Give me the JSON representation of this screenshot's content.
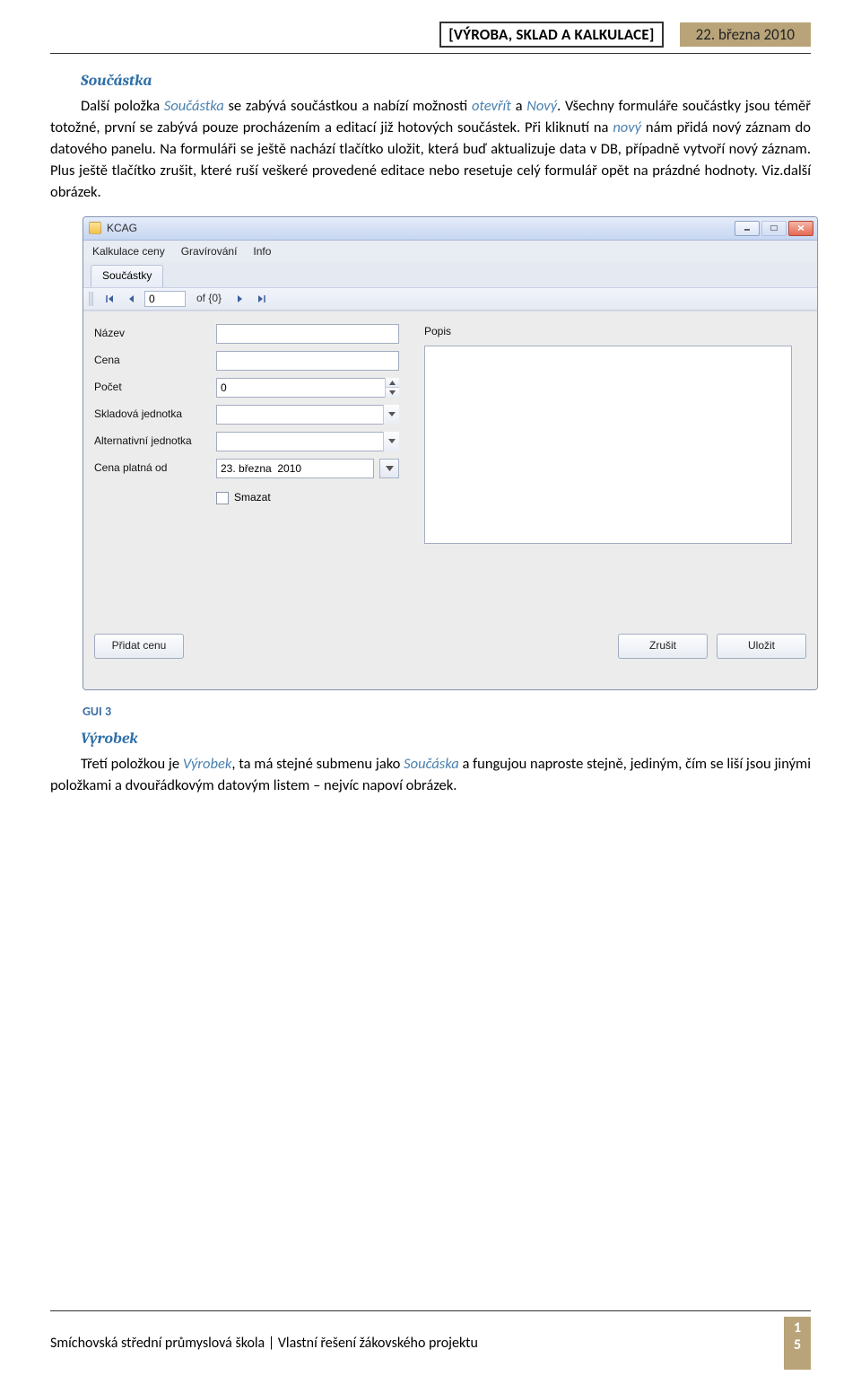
{
  "doc": {
    "header_title": "[VÝROBA, SKLAD A KALKULACE]",
    "header_date": "22. března 2010",
    "section1_heading": "Součástka",
    "paragraph1_a": "Další položka ",
    "paragraph1_link1": "Součástka",
    "paragraph1_b": " se zabývá součástkou a nabízí možnosti ",
    "paragraph1_link2": "otevřít",
    "paragraph1_c": " a ",
    "paragraph1_link3": "Nový",
    "paragraph1_d": ". Všechny formuláře součástky jsou téměř totožné, první se zabývá pouze procházením a editací již hotových součástek. Při kliknutí na ",
    "paragraph1_link4": "nový",
    "paragraph1_e": " nám přidá nový záznam do datového panelu. Na formuláři se ještě nachází tlačítko uložit, která buď aktualizuje data v DB, případně vytvoří nový záznam. Plus ještě tlačítko zrušit, které ruší veškeré provedené editace nebo resetuje celý formulář opět na prázdné hodnoty. Viz.další obrázek.",
    "gui_caption": "GUI 3",
    "section2_heading": "Výrobek",
    "paragraph2_a": "Třetí položkou je ",
    "paragraph2_link1": "Výrobek",
    "paragraph2_b": ", ta má stejné submenu jako ",
    "paragraph2_link2": "Součáska",
    "paragraph2_c": " a fungujou naproste stejně, jediným, čím se liší jsou jinými položkami a dvouřádkovým datovým listem – nejvíc napoví obrázek.",
    "footer_text": "Smíchovská střední průmyslová škola | Vlastní řešení žákovského projektu",
    "footer_page_a": "1",
    "footer_page_b": "5"
  },
  "app": {
    "title": "KCAG",
    "menu": {
      "item1": "Kalkulace ceny",
      "item2": "Gravírování",
      "item3": "Info"
    },
    "tab": "Součástky",
    "nav": {
      "pos_value": "0",
      "of_label": "of {0}"
    },
    "form": {
      "label_name": "Název",
      "value_name": "",
      "label_price": "Cena",
      "value_price": "",
      "label_count": "Počet",
      "value_count": "0",
      "label_unit": "Skladová jednotka",
      "value_unit": "",
      "label_altunit": "Alternativní jednotka",
      "value_altunit": "",
      "label_validfrom": "Cena platná od",
      "value_validfrom": "23. března  2010",
      "label_delete": "Smazat",
      "label_desc": "Popis"
    },
    "buttons": {
      "add_price": "Přidat cenu",
      "cancel": "Zrušit",
      "save": "Uložit"
    }
  }
}
